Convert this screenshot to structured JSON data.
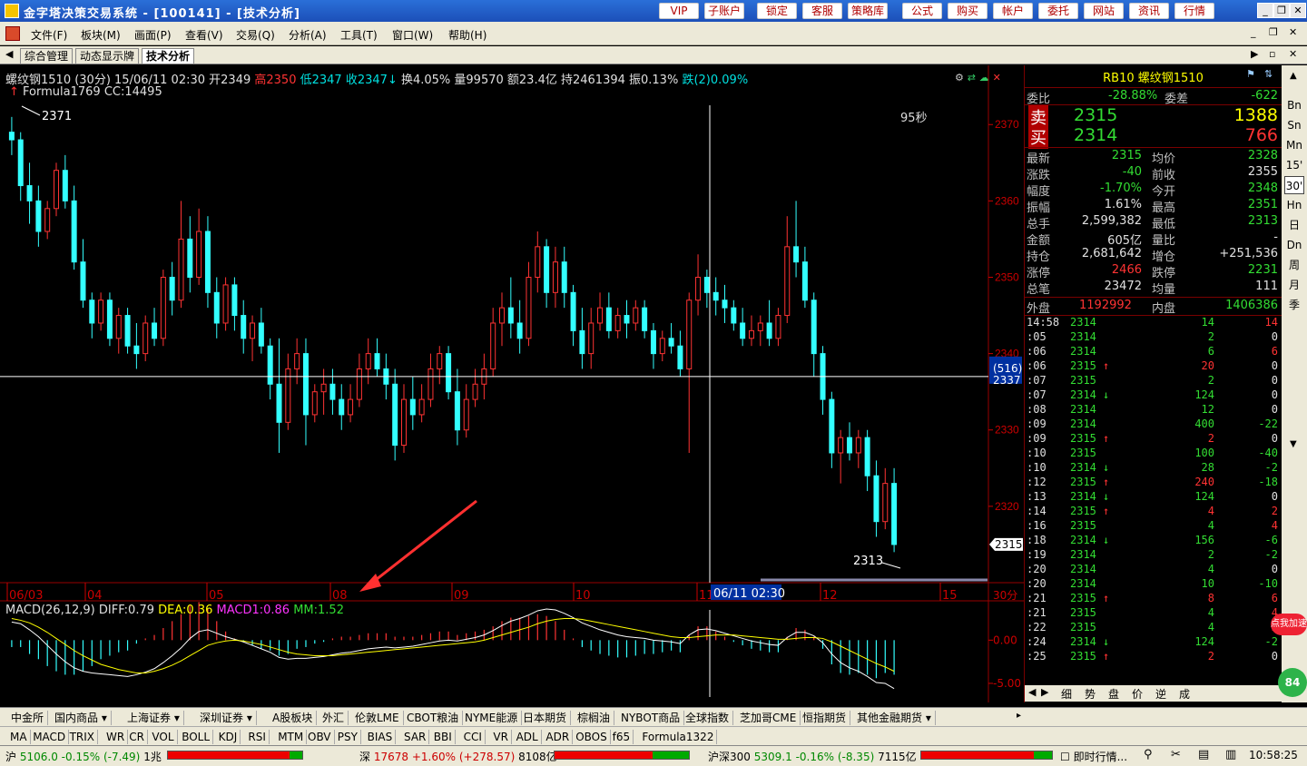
{
  "window": {
    "title": "金字塔决策交易系统 - [100141] - [技术分析]"
  },
  "toolbar_buttons": [
    "VIP",
    "子账户",
    "锁定",
    "客服",
    "策略库",
    "公式",
    "购买",
    "帐户",
    "委托",
    "网站",
    "资讯",
    "行情"
  ],
  "menus": [
    "文件(F)",
    "板块(M)",
    "画面(P)",
    "查看(V)",
    "交易(Q)",
    "分析(A)",
    "工具(T)",
    "窗口(W)",
    "帮助(H)"
  ],
  "tabs": [
    "综合管理",
    "动态显示牌",
    "技术分析"
  ],
  "chart": {
    "header": "螺纹钢1510 (30分) 15/06/11 02:30 开2349",
    "high": "高2350",
    "low": "低2347",
    "close": "收2347",
    "chg_rest": "换4.05% 量99570 额23.4亿 持2461394 振0.13%",
    "fall": "跌(2)0.09%",
    "formula": "Formula1769 CC:14495",
    "max_label": "2371",
    "min_label": "2313",
    "timer": "95秒",
    "crosshair_price": "2337",
    "crosshair_count": "(516)",
    "last_price": "2315",
    "cursor_time": "06/11 02:30",
    "period": "30分",
    "y_ticks": [
      "2370",
      "2360",
      "2350",
      "2340",
      "2330",
      "2320"
    ],
    "x_ticks": [
      "06/03",
      "04",
      "05",
      "08",
      "09",
      "10",
      "11",
      "12",
      "15"
    ],
    "macd_header": {
      "name": "MACD(26,12,9)",
      "diff": "DIFF:0.79",
      "dea": "DEA:0.36",
      "macd1": "MACD1:0.86",
      "mm": "MM:1.52"
    },
    "macd_ticks": [
      "0.00",
      "-5.00"
    ]
  },
  "chart_data": {
    "type": "candlestick",
    "ylim": [
      2310,
      2373
    ],
    "candles": [
      [
        2369,
        2371,
        2366,
        2368
      ],
      [
        2368,
        2369,
        2360,
        2362
      ],
      [
        2362,
        2365,
        2357,
        2360
      ],
      [
        2360,
        2362,
        2354,
        2356
      ],
      [
        2356,
        2360,
        2355,
        2359
      ],
      [
        2359,
        2365,
        2358,
        2364
      ],
      [
        2364,
        2366,
        2359,
        2360
      ],
      [
        2360,
        2362,
        2351,
        2352
      ],
      [
        2352,
        2355,
        2346,
        2347
      ],
      [
        2347,
        2348,
        2342,
        2344
      ],
      [
        2344,
        2348,
        2343,
        2347
      ],
      [
        2347,
        2348,
        2341,
        2342
      ],
      [
        2342,
        2346,
        2340,
        2345
      ],
      [
        2345,
        2346,
        2340,
        2341
      ],
      [
        2341,
        2344,
        2338,
        2340
      ],
      [
        2340,
        2345,
        2339,
        2344
      ],
      [
        2344,
        2346,
        2341,
        2342
      ],
      [
        2342,
        2351,
        2341,
        2350
      ],
      [
        2350,
        2352,
        2345,
        2347
      ],
      [
        2347,
        2360,
        2346,
        2355
      ],
      [
        2355,
        2358,
        2348,
        2350
      ],
      [
        2350,
        2359,
        2349,
        2356
      ],
      [
        2356,
        2358,
        2346,
        2348
      ],
      [
        2348,
        2350,
        2342,
        2344
      ],
      [
        2344,
        2350,
        2343,
        2349
      ],
      [
        2349,
        2350,
        2343,
        2345
      ],
      [
        2345,
        2347,
        2340,
        2342
      ],
      [
        2342,
        2345,
        2339,
        2344
      ],
      [
        2344,
        2346,
        2340,
        2341
      ],
      [
        2341,
        2342,
        2334,
        2336
      ],
      [
        2336,
        2342,
        2327,
        2331
      ],
      [
        2331,
        2340,
        2330,
        2338
      ],
      [
        2338,
        2342,
        2336,
        2340
      ],
      [
        2340,
        2342,
        2328,
        2332
      ],
      [
        2332,
        2336,
        2331,
        2335
      ],
      [
        2335,
        2338,
        2332,
        2336
      ],
      [
        2336,
        2338,
        2332,
        2334
      ],
      [
        2334,
        2336,
        2330,
        2332
      ],
      [
        2332,
        2336,
        2331,
        2334
      ],
      [
        2334,
        2340,
        2333,
        2338
      ],
      [
        2338,
        2342,
        2336,
        2340
      ],
      [
        2340,
        2342,
        2337,
        2338
      ],
      [
        2338,
        2340,
        2334,
        2336
      ],
      [
        2336,
        2338,
        2326,
        2328
      ],
      [
        2328,
        2336,
        2327,
        2334
      ],
      [
        2334,
        2337,
        2330,
        2332
      ],
      [
        2332,
        2336,
        2331,
        2334
      ],
      [
        2334,
        2340,
        2333,
        2338
      ],
      [
        2338,
        2341,
        2336,
        2340
      ],
      [
        2340,
        2341,
        2334,
        2335
      ],
      [
        2335,
        2338,
        2328,
        2330
      ],
      [
        2330,
        2336,
        2329,
        2334
      ],
      [
        2334,
        2338,
        2333,
        2336
      ],
      [
        2336,
        2340,
        2334,
        2338
      ],
      [
        2338,
        2346,
        2337,
        2344
      ],
      [
        2344,
        2348,
        2341,
        2346
      ],
      [
        2346,
        2350,
        2342,
        2344
      ],
      [
        2344,
        2347,
        2340,
        2342
      ],
      [
        2342,
        2352,
        2341,
        2350
      ],
      [
        2350,
        2356,
        2348,
        2354
      ],
      [
        2354,
        2355,
        2346,
        2348
      ],
      [
        2348,
        2354,
        2346,
        2352
      ],
      [
        2352,
        2354,
        2346,
        2348
      ],
      [
        2348,
        2349,
        2341,
        2343
      ],
      [
        2343,
        2346,
        2338,
        2340
      ],
      [
        2340,
        2346,
        2338,
        2344
      ],
      [
        2344,
        2348,
        2343,
        2346
      ],
      [
        2346,
        2348,
        2342,
        2343
      ],
      [
        2343,
        2346,
        2342,
        2345
      ],
      [
        2345,
        2347,
        2342,
        2344
      ],
      [
        2344,
        2347,
        2343,
        2346
      ],
      [
        2346,
        2347,
        2342,
        2343
      ],
      [
        2343,
        2344,
        2338,
        2340
      ],
      [
        2340,
        2343,
        2339,
        2342
      ],
      [
        2342,
        2344,
        2340,
        2341
      ],
      [
        2341,
        2343,
        2337,
        2338
      ],
      [
        2338,
        2348,
        2327,
        2347
      ],
      [
        2347,
        2353,
        2345,
        2350
      ],
      [
        2350,
        2351,
        2346,
        2348
      ],
      [
        2348,
        2350,
        2345,
        2347
      ],
      [
        2347,
        2349,
        2344,
        2346
      ],
      [
        2346,
        2347,
        2343,
        2344
      ],
      [
        2344,
        2346,
        2341,
        2342
      ],
      [
        2342,
        2345,
        2341,
        2343
      ],
      [
        2343,
        2345,
        2341,
        2344
      ],
      [
        2344,
        2347,
        2341,
        2342
      ],
      [
        2342,
        2346,
        2341,
        2345
      ],
      [
        2345,
        2358,
        2344,
        2354
      ],
      [
        2354,
        2360,
        2350,
        2352
      ],
      [
        2352,
        2354,
        2346,
        2347
      ],
      [
        2347,
        2348,
        2337,
        2340
      ],
      [
        2340,
        2341,
        2332,
        2334
      ],
      [
        2334,
        2335,
        2325,
        2327
      ],
      [
        2327,
        2330,
        2323,
        2329
      ],
      [
        2329,
        2331,
        2326,
        2327
      ],
      [
        2327,
        2330,
        2325,
        2329
      ],
      [
        2329,
        2330,
        2322,
        2324
      ],
      [
        2324,
        2326,
        2316,
        2318
      ],
      [
        2318,
        2325,
        2317,
        2323
      ],
      [
        2323,
        2325,
        2314,
        2315
      ]
    ],
    "macd": [
      2.1,
      1.9,
      1.2,
      0.4,
      -0.6,
      -1.6,
      -2.5,
      -3.2,
      -3.6,
      -3.8,
      -3.9,
      -4.0,
      -4.1,
      -4.2,
      -4.0,
      -3.7,
      -3.3,
      -2.6,
      -1.8,
      -0.9,
      0.2,
      1.0,
      1.2,
      0.8,
      0.4,
      0.1,
      -0.2,
      -0.6,
      -1.0,
      -1.4,
      -2.0,
      -2.2,
      -2.1,
      -2.1,
      -2.0,
      -1.9,
      -1.7,
      -1.5,
      -1.4,
      -1.2,
      -1.0,
      -0.9,
      -0.8,
      -0.9,
      -0.8,
      -0.7,
      -0.5,
      -0.3,
      -0.1,
      0.0,
      -0.1,
      0.1,
      0.3,
      0.6,
      1.1,
      1.7,
      2.2,
      2.5,
      2.9,
      3.4,
      3.6,
      3.5,
      3.1,
      2.6,
      2.0,
      1.6,
      1.2,
      0.9,
      0.6,
      0.4,
      0.3,
      0.2,
      0.0,
      -0.1,
      -0.2,
      -0.4,
      0.6,
      1.2,
      1.3,
      1.1,
      0.8,
      0.5,
      0.2,
      -0.1,
      -0.3,
      -0.5,
      -0.6,
      0.3,
      0.9,
      0.9,
      0.5,
      -0.3,
      -1.6,
      -2.6,
      -3.2,
      -3.6,
      -4.2,
      -4.9,
      -5.0,
      -5.6
    ],
    "dea": [
      2.5,
      2.3,
      2.0,
      1.5,
      0.9,
      0.2,
      -0.5,
      -1.2,
      -1.8,
      -2.3,
      -2.8,
      -3.1,
      -3.4,
      -3.6,
      -3.8,
      -3.8,
      -3.6,
      -3.3,
      -2.9,
      -2.4,
      -1.8,
      -1.2,
      -0.6,
      -0.3,
      -0.1,
      0.0,
      -0.1,
      -0.3,
      -0.5,
      -0.8,
      -1.1,
      -1.4,
      -1.6,
      -1.7,
      -1.8,
      -1.8,
      -1.8,
      -1.7,
      -1.6,
      -1.5,
      -1.4,
      -1.3,
      -1.2,
      -1.1,
      -1.0,
      -0.9,
      -0.8,
      -0.7,
      -0.6,
      -0.5,
      -0.4,
      -0.3,
      -0.2,
      0.0,
      0.3,
      0.6,
      0.9,
      1.2,
      1.5,
      1.9,
      2.2,
      2.4,
      2.5,
      2.5,
      2.4,
      2.2,
      2.0,
      1.8,
      1.6,
      1.4,
      1.2,
      1.0,
      0.8,
      0.6,
      0.4,
      0.3,
      0.3,
      0.4,
      0.5,
      0.6,
      0.6,
      0.6,
      0.5,
      0.4,
      0.3,
      0.2,
      0.1,
      0.1,
      0.2,
      0.3,
      0.3,
      0.2,
      -0.2,
      -0.7,
      -1.2,
      -1.7,
      -2.2,
      -2.7,
      -3.1,
      -3.6
    ],
    "macd_ylim": [
      -7,
      3.5
    ]
  },
  "quote": {
    "code": "RB10",
    "name": "螺纹钢1510",
    "weibi_label": "委比",
    "weibi": "-28.88%",
    "weicha_label": "委差",
    "weicha": "-622",
    "sell_label": "卖",
    "sell_price": "2315",
    "sell_vol": "1388",
    "buy_label": "买",
    "buy_price": "2314",
    "buy_vol": "766",
    "rows": [
      {
        "l1": "最新",
        "v1": "2315",
        "c1": "grn",
        "l2": "均价",
        "v2": "2328",
        "c2": "grn"
      },
      {
        "l1": "涨跌",
        "v1": "-40",
        "c1": "grn",
        "l2": "前收",
        "v2": "2355",
        "c2": "wht"
      },
      {
        "l1": "幅度",
        "v1": "-1.70%",
        "c1": "grn",
        "l2": "今开",
        "v2": "2348",
        "c2": "grn"
      },
      {
        "l1": "振幅",
        "v1": "1.61%",
        "c1": "wht",
        "l2": "最高",
        "v2": "2351",
        "c2": "grn"
      },
      {
        "l1": "总手",
        "v1": "2,599,382",
        "c1": "wht",
        "l2": "最低",
        "v2": "2313",
        "c2": "grn"
      },
      {
        "l1": "金额",
        "v1": "605亿",
        "c1": "wht",
        "l2": "量比",
        "v2": "-",
        "c2": "wht"
      },
      {
        "l1": "持仓",
        "v1": "2,681,642",
        "c1": "wht",
        "l2": "增仓",
        "v2": "+251,536",
        "c2": "wht"
      },
      {
        "l1": "涨停",
        "v1": "2466",
        "c1": "red",
        "l2": "跌停",
        "v2": "2231",
        "c2": "grn"
      },
      {
        "l1": "总笔",
        "v1": "23472",
        "c1": "wht",
        "l2": "均量",
        "v2": "111",
        "c2": "wht"
      }
    ],
    "outer_label": "外盘",
    "outer": "1192992",
    "inner_label": "内盘",
    "inner": "1406386",
    "ticks": [
      {
        "t": "14:58",
        "p": "2314",
        "a": "",
        "v": "14",
        "o": "14"
      },
      {
        "t": ":05",
        "p": "2314",
        "a": "",
        "v": "2",
        "o": "0"
      },
      {
        "t": ":06",
        "p": "2314",
        "a": "",
        "v": "6",
        "o": "6"
      },
      {
        "t": ":06",
        "p": "2315",
        "a": "↑",
        "v": "20",
        "o": "0"
      },
      {
        "t": ":07",
        "p": "2315",
        "a": "",
        "v": "2",
        "o": "0"
      },
      {
        "t": ":07",
        "p": "2314",
        "a": "↓",
        "v": "124",
        "o": "0"
      },
      {
        "t": ":08",
        "p": "2314",
        "a": "",
        "v": "12",
        "o": "0"
      },
      {
        "t": ":09",
        "p": "2314",
        "a": "",
        "v": "400",
        "o": "-22"
      },
      {
        "t": ":09",
        "p": "2315",
        "a": "↑",
        "v": "2",
        "o": "0"
      },
      {
        "t": ":10",
        "p": "2315",
        "a": "",
        "v": "100",
        "o": "-40"
      },
      {
        "t": ":10",
        "p": "2314",
        "a": "↓",
        "v": "28",
        "o": "-2"
      },
      {
        "t": ":12",
        "p": "2315",
        "a": "↑",
        "v": "240",
        "o": "-18"
      },
      {
        "t": ":13",
        "p": "2314",
        "a": "↓",
        "v": "124",
        "o": "0"
      },
      {
        "t": ":14",
        "p": "2315",
        "a": "↑",
        "v": "4",
        "o": "2"
      },
      {
        "t": ":16",
        "p": "2315",
        "a": "",
        "v": "4",
        "o": "4"
      },
      {
        "t": ":18",
        "p": "2314",
        "a": "↓",
        "v": "156",
        "o": "-6"
      },
      {
        "t": ":19",
        "p": "2314",
        "a": "",
        "v": "2",
        "o": "-2"
      },
      {
        "t": ":20",
        "p": "2314",
        "a": "",
        "v": "4",
        "o": "0"
      },
      {
        "t": ":20",
        "p": "2314",
        "a": "",
        "v": "10",
        "o": "-10"
      },
      {
        "t": ":21",
        "p": "2315",
        "a": "↑",
        "v": "8",
        "o": "6"
      },
      {
        "t": ":21",
        "p": "2315",
        "a": "",
        "v": "4",
        "o": "4"
      },
      {
        "t": ":22",
        "p": "2315",
        "a": "",
        "v": "4",
        "o": "2"
      },
      {
        "t": ":24",
        "p": "2314",
        "a": "↓",
        "v": "124",
        "o": "-2"
      },
      {
        "t": ":25",
        "p": "2315",
        "a": "↑",
        "v": "2",
        "o": "0"
      }
    ],
    "subtabs": [
      "细",
      "势",
      "盘",
      "价",
      "逆",
      "成"
    ]
  },
  "sidebar": [
    "Bn",
    "Sn",
    "Mn",
    "15'",
    "30'",
    "Hn",
    "日",
    "Dn",
    "周",
    "月",
    "季"
  ],
  "bottom_row1": [
    "中金所",
    "国内商品 ▾",
    "上海证券 ▾",
    "深圳证券 ▾",
    "A股板块",
    "外汇",
    "伦敦LME",
    "CBOT粮油",
    "NYME能源",
    "日本期货",
    "棕榈油",
    "NYBOT商品",
    "全球指数",
    "芝加哥CME",
    "恒指期货",
    "其他金融期货 ▾"
  ],
  "bottom_row2": [
    "MA",
    "MACD",
    "TRIX",
    "WR",
    "CR",
    "VOL",
    "BOLL",
    "KDJ",
    "RSI",
    "MTM",
    "OBV",
    "PSY",
    "BIAS",
    "SAR",
    "BBI",
    "CCI",
    "VR",
    "ADL",
    "ADR",
    "OBOS",
    "f65",
    "Formula1322"
  ],
  "status": {
    "sh_label": "沪",
    "sh": "5106.0",
    "sh_chg": "-0.15%",
    "sh_diff": "(-7.49)",
    "sh_amt": "1兆",
    "sz_label": "深",
    "sz": "17678",
    "sz_chg": "+1.60%",
    "sz_diff": "(+278.57)",
    "sz_amt": "8108亿",
    "hs_label": "沪深300",
    "hs": "5309.1",
    "hs_chg": "-0.16%",
    "hs_diff": "(-8.35)",
    "hs_amt": "7115亿",
    "news": "即时行情...",
    "clock": "10:58:25"
  },
  "promo": "点我加速",
  "promo_num": "84"
}
